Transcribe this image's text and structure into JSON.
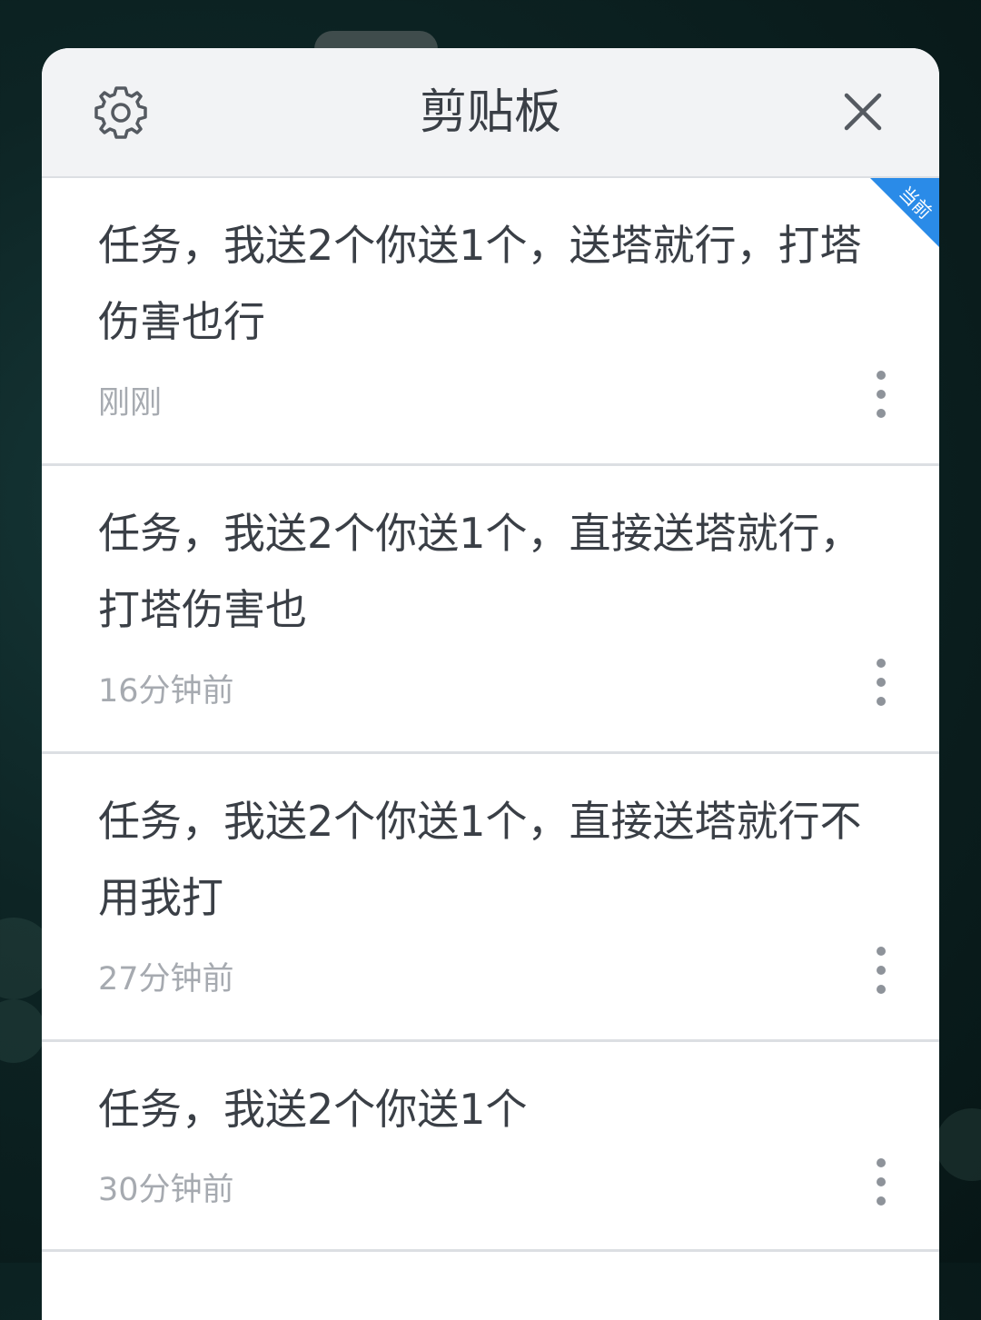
{
  "header": {
    "title": "剪贴板",
    "settings_icon": "gear-icon",
    "close_icon": "close-icon"
  },
  "current_badge": "当前",
  "colors": {
    "badge": "#2a8be8",
    "text": "#3a3f46",
    "time": "#a6aab0",
    "header_bg": "#f2f3f5"
  },
  "items": [
    {
      "text": "任务，我送2个你送1个，送塔就行，打塔伤害也行",
      "time": "刚刚",
      "current": true
    },
    {
      "text": "任务，我送2个你送1个，直接送塔就行，打塔伤害也",
      "time": "16分钟前",
      "current": false
    },
    {
      "text": "任务，我送2个你送1个，直接送塔就行不用我打",
      "time": "27分钟前",
      "current": false
    },
    {
      "text": "任务，我送2个你送1个",
      "time": "30分钟前",
      "current": false
    }
  ]
}
